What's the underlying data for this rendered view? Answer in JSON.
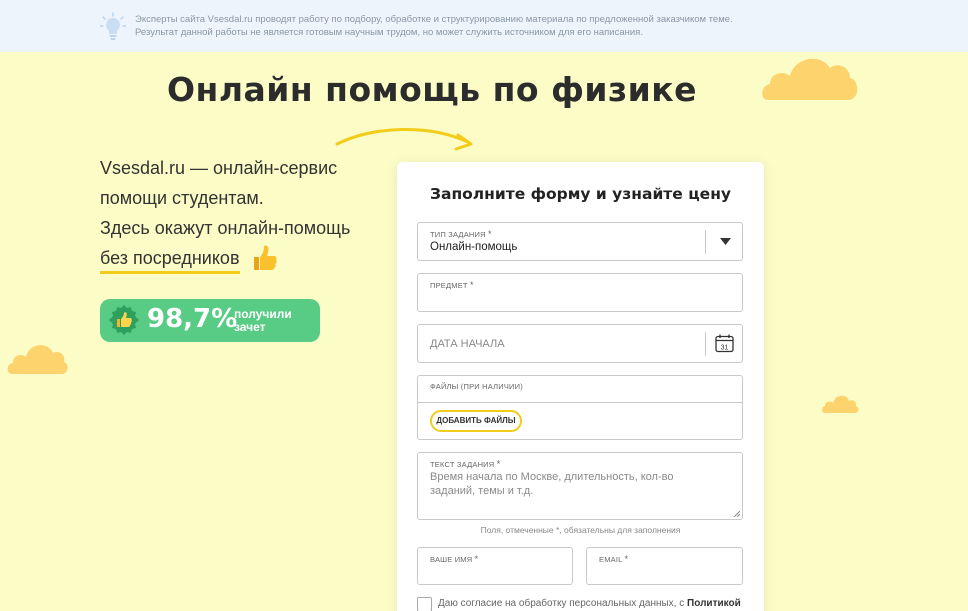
{
  "notice": {
    "line1": "Эксперты сайта Vsesdal.ru проводят работу по подбору, обработке и структурированию материала по предложенной заказчиком теме.",
    "line2": "Результат данной работы не является готовым научным трудом, но может служить источником для его написания."
  },
  "hero": {
    "title": "Онлайн помощь по физике",
    "intro_line1": "Vsesdal.ru — онлайн-сервис",
    "intro_line2": "помощи студентам.",
    "intro_line3": "Здесь окажут онлайн-помощь",
    "intro_line4": "без посредников"
  },
  "stats": {
    "percent": "98,7%",
    "label_line1": "получили",
    "label_line2": "зачет"
  },
  "form": {
    "heading": "Заполните форму и узнайте цену",
    "type_label": "ТИП ЗАДАНИЯ",
    "type_value": "Онлайн-помощь",
    "subject_label": "ПРЕДМЕТ",
    "date_placeholder": "ДАТА НАЧАЛА",
    "calendar_day": "31",
    "files_label": "ФАЙЛЫ (ПРИ НАЛИЧИИ)",
    "add_files_button": "ДОБАВИТЬ ФАЙЛЫ",
    "text_label": "ТЕКСТ ЗАДАНИЯ",
    "text_placeholder": "Время начала по Москве, длительность, кол-во заданий, темы и т.д.",
    "required_hint": "Поля, отмеченные *, обязательны для заполнения",
    "name_label": "ВАШЕ ИМЯ",
    "email_label": "EMAIL",
    "required_mark": "*",
    "consent_text": "Даю согласие на обработку персональных данных, с",
    "consent_link": "Политикой"
  },
  "colors": {
    "background": "#fbfcc6",
    "accent_yellow": "#f2cc1a",
    "stats_green": "#58cc84",
    "notice_bg": "#eef4fb"
  },
  "icons": {
    "notice": "lightbulb-icon",
    "intro": "thumbs-up-icon",
    "stats": "thumbs-up-badge-icon",
    "type_select": "chevron-down-icon",
    "date": "calendar-icon"
  }
}
